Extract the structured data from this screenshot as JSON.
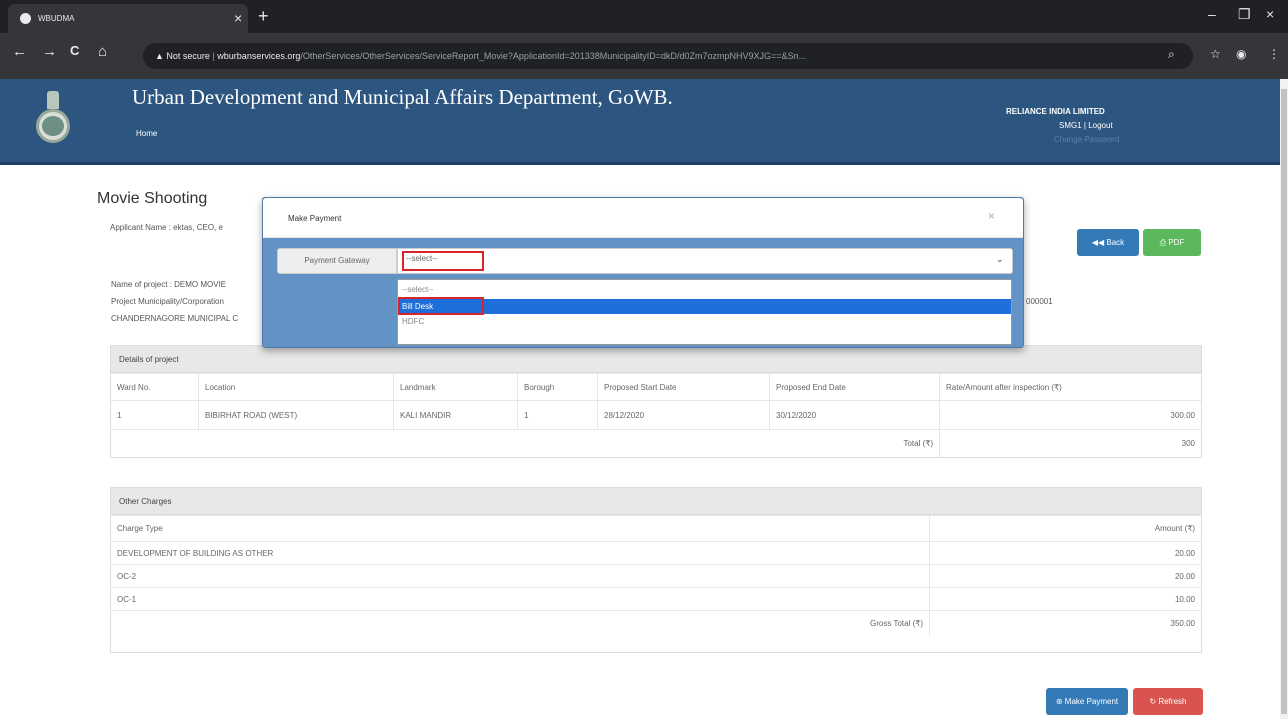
{
  "browser": {
    "tab_title": "WBUDMA",
    "tab_close": "×",
    "new_tab": "+",
    "window_controls": [
      "–",
      "❐",
      "×"
    ],
    "nav": [
      "←",
      "→",
      "C",
      "⌂"
    ],
    "security_label": "▲ Not secure",
    "url_host": "wburbanservices.org",
    "url_path": "/OtherServices/OtherServices/ServiceReport_Movie?ApplicationId=201338MunicipalityID=dkD/d0Zm7ozmpNHV9XJG==&Sn...",
    "omni_icons": [
      "search-icon",
      "star-icon",
      "extension-icon",
      "menu-icon"
    ]
  },
  "header": {
    "title": "Urban Development and Municipal Affairs Department, GoWB.",
    "home_link": "Home",
    "company": "RELIANCE INDIA LIMITED",
    "user_line": "SMG1 | Logout",
    "change_password": "Change Password"
  },
  "page": {
    "heading": "Movie Shooting",
    "applicant": "Applicant Name : ektas, CEO, e",
    "project_lines": [
      "Name of project : DEMO MOVIE",
      "Project Municipality/Corporation",
      "CHANDERNAGORE MUNICIPAL C"
    ],
    "project_suffix": "000001",
    "back_button": "Back",
    "pdf_button": "PDF",
    "make_payment_button": "Make Payment",
    "refresh_button": "Refresh"
  },
  "project_table": {
    "title": "Details of project",
    "headers": [
      "Ward No.",
      "Location",
      "Landmark",
      "Borough",
      "Proposed Start Date",
      "Proposed End Date",
      "Rate/Amount after inspection (₹)"
    ],
    "row": [
      "1",
      "BIBIRHAT ROAD (WEST)",
      "KALI MANDIR",
      "1",
      "28/12/2020",
      "30/12/2020",
      "300.00"
    ],
    "total_label": "Total (₹)",
    "total_value": "300"
  },
  "charges_table": {
    "title": "Other Charges",
    "headers": [
      "Charge Type",
      "Amount (₹)"
    ],
    "rows": [
      [
        "DEVELOPMENT OF BUILDING AS OTHER",
        "20.00"
      ],
      [
        "OC-2",
        "20.00"
      ],
      [
        "OC-1",
        "10.00"
      ]
    ],
    "gross_total_label": "Gross Total (₹)",
    "gross_total_value": "350.00"
  },
  "modal": {
    "title": "Make Payment",
    "close": "×",
    "gateway_label": "Payment Gateway",
    "selected_value": "--select--",
    "options": [
      "--select--",
      "Bill Desk",
      "HDFC"
    ],
    "highlighted_option": "Bill Desk"
  },
  "colors": {
    "header_bg": "#2c5680",
    "modal_body": "#6393c4",
    "back_btn": "#337ab7",
    "pdf_btn": "#5cb85c",
    "refresh_btn": "#d9534f",
    "highlight_red": "#d9242e"
  }
}
